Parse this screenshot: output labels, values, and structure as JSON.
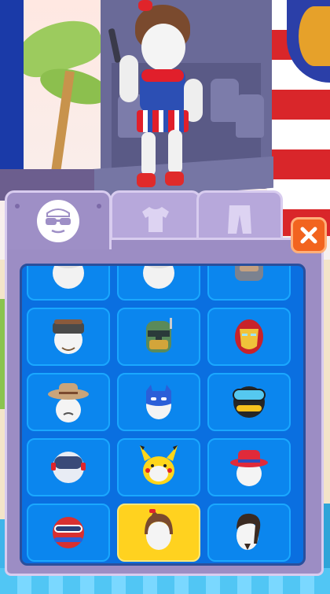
{
  "panel": {
    "tabs": [
      {
        "name": "hats",
        "icon": "sunglasses-face-icon",
        "active": true
      },
      {
        "name": "shirts",
        "icon": "shirt-icon",
        "active": false
      },
      {
        "name": "pants",
        "icon": "pants-icon",
        "active": false
      }
    ],
    "close_icon": "close-x-icon"
  },
  "colors": {
    "panel": "#9c8dc4",
    "grid": "#0a6fe0",
    "cell": "#0b86ee",
    "selected_cell": "#ffd21f",
    "close_button": "#f2641f"
  },
  "items": [
    {
      "icon": "helmet-white-icon",
      "selected": false
    },
    {
      "icon": "helmet-white-icon",
      "selected": false
    },
    {
      "icon": "robot-helmet-icon",
      "selected": false
    },
    {
      "icon": "visor-headband-icon",
      "selected": false
    },
    {
      "icon": "bounty-hunter-helmet-icon",
      "selected": false
    },
    {
      "icon": "iron-hero-helmet-icon",
      "selected": false
    },
    {
      "icon": "cowboy-hat-icon",
      "selected": false
    },
    {
      "icon": "blue-hero-mask-icon",
      "selected": false
    },
    {
      "icon": "ski-goggles-helmet-icon",
      "selected": false
    },
    {
      "icon": "astronaut-helmet-icon",
      "selected": false
    },
    {
      "icon": "pikachu-hood-icon",
      "selected": false
    },
    {
      "icon": "red-bucket-hat-icon",
      "selected": false
    },
    {
      "icon": "racing-helmet-icon",
      "selected": false
    },
    {
      "icon": "brown-hair-icon",
      "selected": true
    },
    {
      "icon": "dark-pompadour-hair-icon",
      "selected": false
    }
  ]
}
